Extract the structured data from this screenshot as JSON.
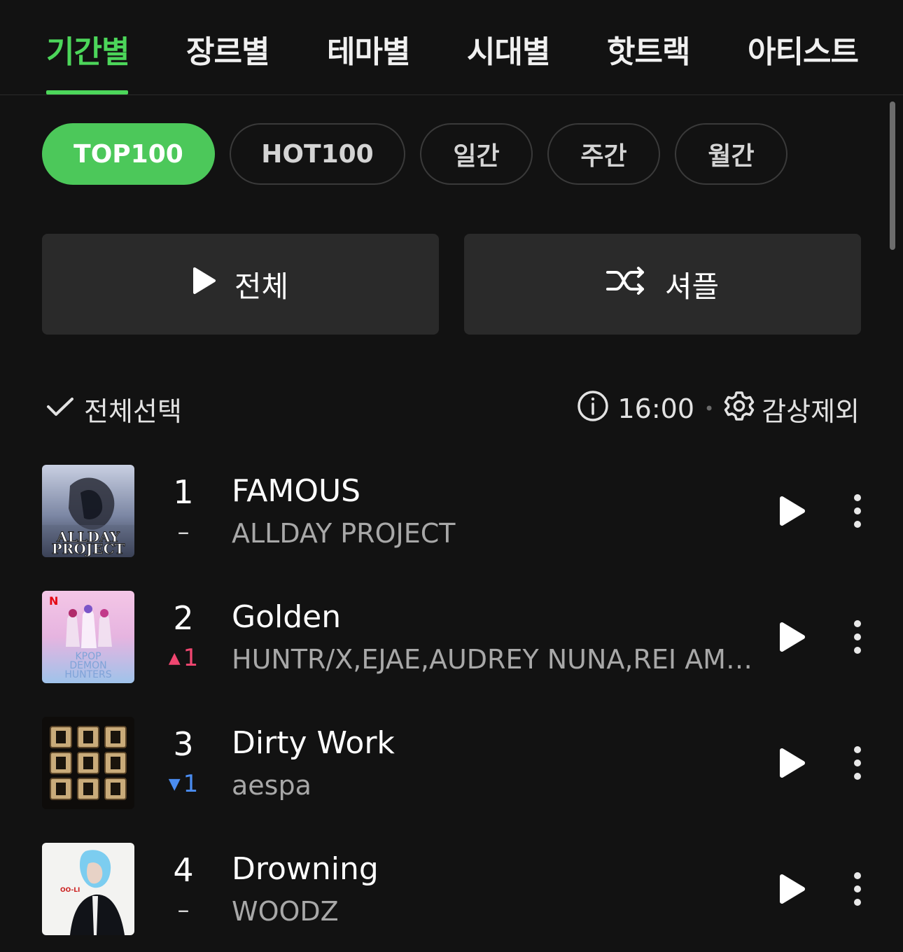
{
  "tabs": [
    {
      "label": "기간별",
      "active": true
    },
    {
      "label": "장르별",
      "active": false
    },
    {
      "label": "테마별",
      "active": false
    },
    {
      "label": "시대별",
      "active": false
    },
    {
      "label": "핫트랙",
      "active": false
    },
    {
      "label": "아티스트",
      "active": false
    }
  ],
  "chips": [
    {
      "label": "TOP100",
      "active": true
    },
    {
      "label": "HOT100",
      "active": false
    },
    {
      "label": "일간",
      "active": false
    },
    {
      "label": "주간",
      "active": false
    },
    {
      "label": "월간",
      "active": false
    }
  ],
  "actions": {
    "play_all_label": "전체",
    "shuffle_label": "셔플"
  },
  "toolbar": {
    "select_all_label": "전체선택",
    "time": "16:00",
    "exclude_label": "감상제외"
  },
  "songs": [
    {
      "rank": "1",
      "change_dir": "same",
      "change": "–",
      "title": "FAMOUS",
      "artist": "ALLDAY PROJECT",
      "cover_text": [
        "ALLDAY",
        "PROJECT"
      ]
    },
    {
      "rank": "2",
      "change_dir": "up",
      "change": "1",
      "title": "Golden",
      "artist": "HUNTR/X,EJAE,AUDREY NUNA,REI AMI...",
      "cover_text": [
        "N",
        "KPOP",
        "DEMON",
        "HUNTERS"
      ]
    },
    {
      "rank": "3",
      "change_dir": "down",
      "change": "1",
      "title": "Dirty Work",
      "artist": "aespa",
      "cover_text": []
    },
    {
      "rank": "4",
      "change_dir": "same",
      "change": "–",
      "title": "Drowning",
      "artist": "WOODZ",
      "cover_text": [
        "OO-LI"
      ]
    }
  ],
  "colors": {
    "accent": "#4cd65a",
    "background": "#121212",
    "button_bg": "#2a2a2a",
    "rank_up": "#f04670",
    "rank_down": "#4a8cf0"
  },
  "icons": {
    "play_all": "play-icon",
    "shuffle": "shuffle-icon",
    "select_all": "checkmark-icon",
    "info": "info-icon",
    "settings": "gear-icon",
    "row_play": "play-icon",
    "row_more": "more-vertical-icon"
  }
}
